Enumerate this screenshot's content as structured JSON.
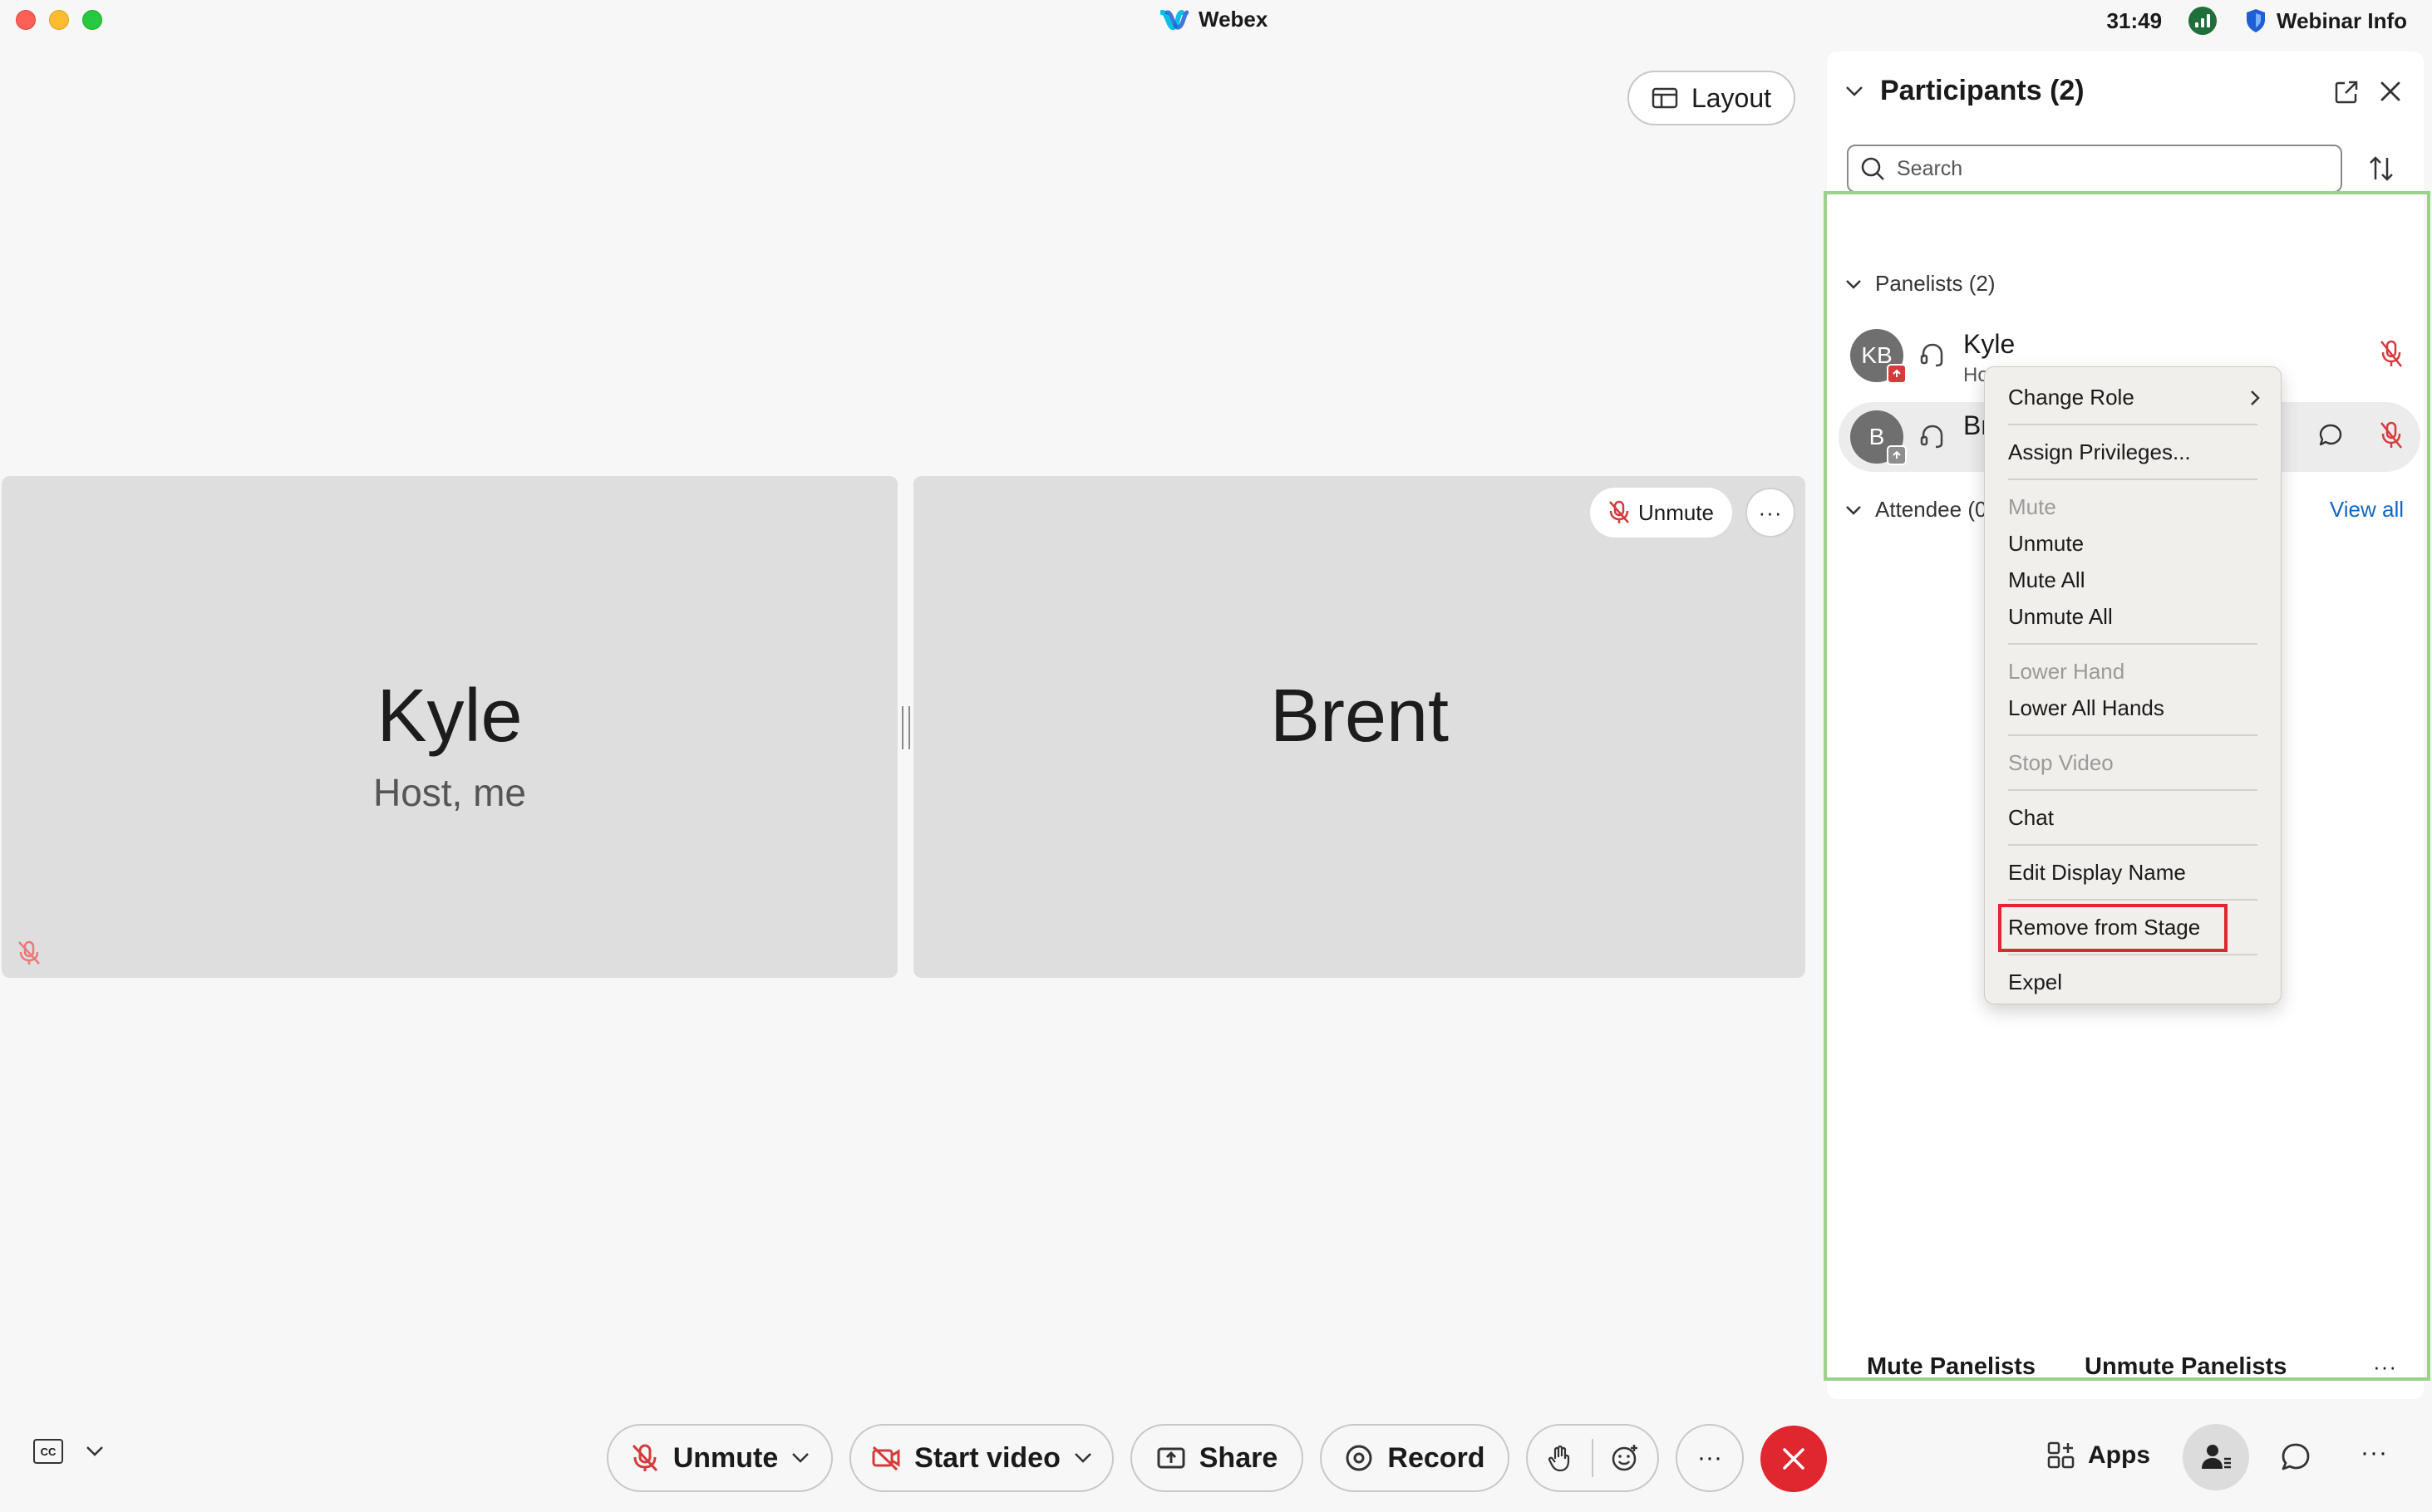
{
  "window": {
    "title": "Webex",
    "timer": "31:49",
    "webinar_info": "Webinar Info"
  },
  "stage": {
    "layout_label": "Layout",
    "tiles": [
      {
        "name": "Kyle",
        "subtitle": "Host, me",
        "muted": true
      },
      {
        "name": "Brent",
        "unmute_label": "Unmute",
        "more_label": "···"
      }
    ]
  },
  "toolbar": {
    "cc_label": "CC",
    "unmute_label": "Unmute",
    "video_label": "Start video",
    "share_label": "Share",
    "record_label": "Record",
    "more_label": "···",
    "apps_label": "Apps",
    "more_right_label": "···"
  },
  "participants": {
    "title": "Participants (2)",
    "search_placeholder": "Search",
    "panelists_header": "Panelists (2)",
    "attendee_header": "Attendee (0)",
    "view_all": "View all",
    "rows": [
      {
        "initials": "KB",
        "name": "Kyle",
        "role": "Host, me",
        "badge_color": "#d63a3a"
      },
      {
        "initials": "B",
        "name": "Brent",
        "badge_color": "#8e8e8e"
      }
    ],
    "footer": {
      "mute_panelists": "Mute Panelists",
      "unmute_panelists": "Unmute Panelists",
      "more_label": "···"
    }
  },
  "context_menu": {
    "items": {
      "change_role": "Change Role",
      "assign_privileges": "Assign Privileges...",
      "mute": "Mute",
      "unmute": "Unmute",
      "mute_all": "Mute All",
      "unmute_all": "Unmute All",
      "lower_hand": "Lower Hand",
      "lower_all_hands": "Lower All Hands",
      "stop_video": "Stop Video",
      "chat": "Chat",
      "edit_display_name": "Edit Display Name",
      "remove_from_stage": "Remove from Stage",
      "expel": "Expel"
    },
    "highlighted_item": "Remove from Stage"
  },
  "colors": {
    "accent_red": "#e0262f",
    "list_border_green": "#9cd18a",
    "link_blue": "#1267c4",
    "muted_mic_red": "#d63a3a"
  }
}
